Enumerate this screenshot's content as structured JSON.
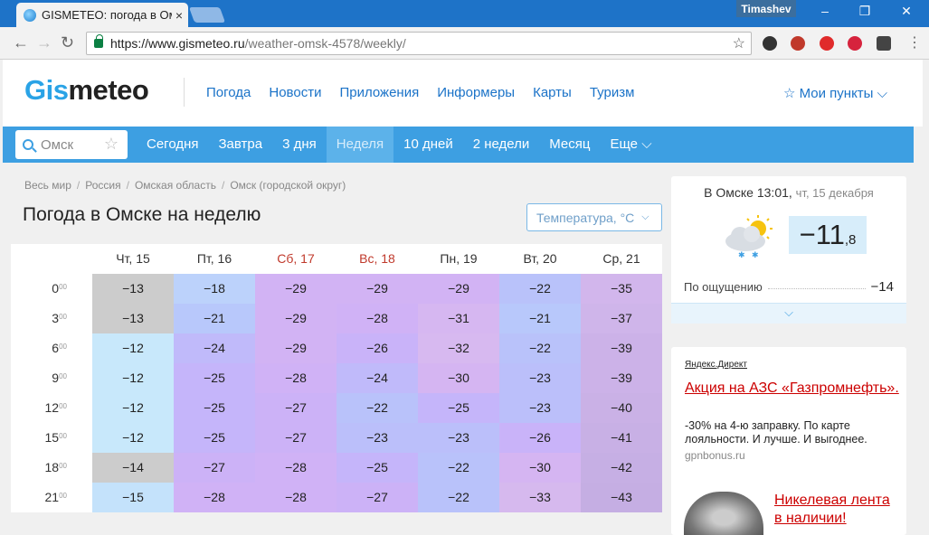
{
  "browser": {
    "tab_title": "GISMETEO: погода в Омс",
    "tab_close": "×",
    "user": "Timashev",
    "url_host": "https://www.gismeteo.ru",
    "url_path": "/weather-omsk-4578/weekly/",
    "window_buttons": [
      "–",
      "❐",
      "✕"
    ]
  },
  "header": {
    "logo_gis": "Gis",
    "logo_meteo": "meteo",
    "nav": [
      "Погода",
      "Новости",
      "Приложения",
      "Информеры",
      "Карты",
      "Туризм"
    ],
    "my_points": "☆ Мои пункты ⌵"
  },
  "subnav": {
    "search_placeholder": "Омск",
    "tabs": [
      "Сегодня",
      "Завтра",
      "3 дня",
      "Неделя",
      "10 дней",
      "2 недели",
      "Месяц",
      "Еще ⌵"
    ],
    "active_tab": "Неделя"
  },
  "main": {
    "breadcrumbs": [
      "Весь мир",
      "Россия",
      "Омская область",
      "Омск (городской округ)"
    ],
    "title": "Погода в Омске на неделю",
    "measure_select": "Температура, °С"
  },
  "forecast": {
    "days": [
      {
        "label": "Чт, 15",
        "weekend": false
      },
      {
        "label": "Пт, 16",
        "weekend": false
      },
      {
        "label": "Сб, 17",
        "weekend": true
      },
      {
        "label": "Вс, 18",
        "weekend": true
      },
      {
        "label": "Пн, 19",
        "weekend": false
      },
      {
        "label": "Вт, 20",
        "weekend": false
      },
      {
        "label": "Ср, 21",
        "weekend": false
      }
    ],
    "hours": [
      "0",
      "3",
      "6",
      "9",
      "12",
      "15",
      "18",
      "21"
    ],
    "minutes": "00",
    "values": [
      [
        "−13",
        "−18",
        "−29",
        "−29",
        "−29",
        "−22",
        "−35"
      ],
      [
        "−13",
        "−21",
        "−29",
        "−28",
        "−31",
        "−21",
        "−37"
      ],
      [
        "−12",
        "−24",
        "−29",
        "−26",
        "−32",
        "−22",
        "−39"
      ],
      [
        "−12",
        "−25",
        "−28",
        "−24",
        "−30",
        "−23",
        "−39"
      ],
      [
        "−12",
        "−25",
        "−27",
        "−22",
        "−25",
        "−23",
        "−40"
      ],
      [
        "−12",
        "−25",
        "−27",
        "−23",
        "−23",
        "−26",
        "−41"
      ],
      [
        "−14",
        "−27",
        "−28",
        "−25",
        "−22",
        "−30",
        "−42"
      ],
      [
        "−15",
        "−28",
        "−28",
        "−27",
        "−22",
        "−33",
        "−43"
      ]
    ],
    "colors": {
      "c12": "#c8e8fb",
      "c15": "#c4e2fb",
      "c18": "#bcd2fb",
      "c21": "#b8c8fb",
      "c22": "#b9c2fa",
      "c23": "#bbbffa",
      "c24": "#c0bafa",
      "c25": "#c5b5fa",
      "c26": "#c9b3f9",
      "c27": "#ccb2f7",
      "c28": "#d0b2f6",
      "c29": "#d2b3f4",
      "c30": "#d5b5f2",
      "c31": "#d6b7f1",
      "c32": "#d7b9f0",
      "c33": "#d6b9ee",
      "c35": "#d2b6ec",
      "c37": "#cfb5ea",
      "c39": "#ccb2e8",
      "c40": "#cab1e6",
      "c41": "#c8b0e5",
      "c42": "#c6afe4",
      "c43": "#c5aee3"
    }
  },
  "now": {
    "header": "В Омске 13:01,",
    "date": "чт, 15 декабря",
    "temp_int": "−11",
    "temp_frac": ",8",
    "feels_label": "По ощущению",
    "feels_value": "−14",
    "expand_icon": "⌵"
  },
  "ad": {
    "source": "Яндекс.Директ",
    "title": "Акция на АЗС «Газпромнефть».",
    "text": "-30% на 4-ю заправку. По карте лояльности. И лучше. И выгоднее.",
    "host": "gpnbonus.ru",
    "title2": "Никелевая лента в наличии!"
  }
}
